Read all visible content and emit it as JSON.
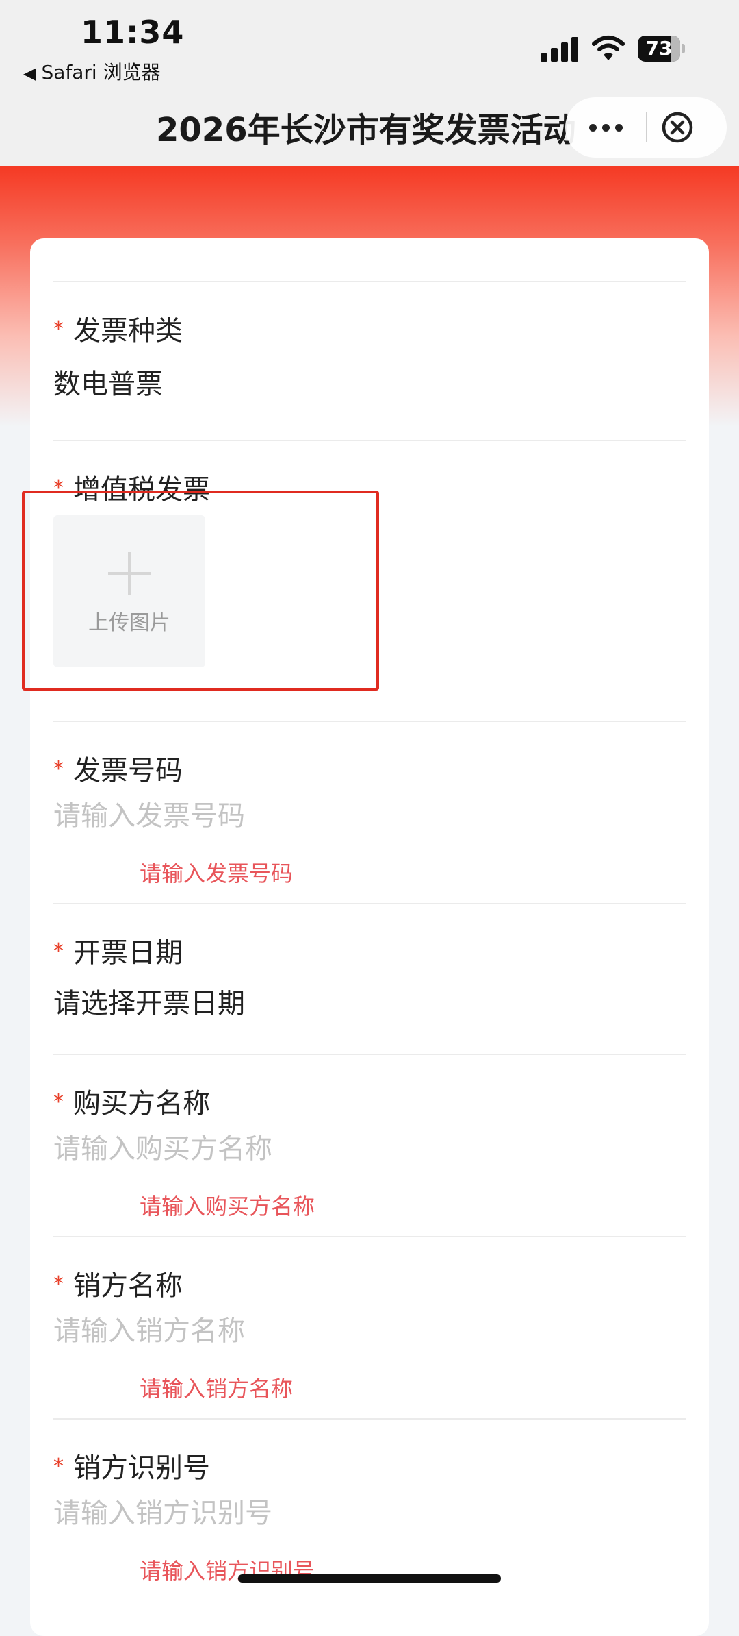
{
  "status_bar": {
    "time": "11:34",
    "back_app": "Safari 浏览器",
    "battery_level": "73",
    "battery_fraction": 0.73
  },
  "nav": {
    "title": "2026年长沙市有奖发票活动",
    "more_icon": "more-dots-icon",
    "close_icon": "close-circle-icon"
  },
  "form": {
    "invoice_type": {
      "label": "发票种类",
      "value": "数电普票"
    },
    "vat_invoice": {
      "label": "增值税发票",
      "upload_label": "上传图片"
    },
    "invoice_number": {
      "label": "发票号码",
      "placeholder": "请输入发票号码",
      "error": "请输入发票号码"
    },
    "issue_date": {
      "label": "开票日期",
      "value": "请选择开票日期"
    },
    "buyer_name": {
      "label": "购买方名称",
      "placeholder": "请输入购买方名称",
      "error": "请输入购买方名称"
    },
    "seller_name": {
      "label": "销方名称",
      "placeholder": "请输入销方名称",
      "error": "请输入销方名称"
    },
    "seller_id": {
      "label": "销方识别号",
      "placeholder": "请输入销方识别号",
      "error": "请输入销方识别号"
    },
    "required_mark": "*"
  },
  "colors": {
    "accent_red": "#f53a24",
    "required_red": "#e8402a",
    "error_red": "#e8555a",
    "highlight_red": "#e02b20"
  }
}
